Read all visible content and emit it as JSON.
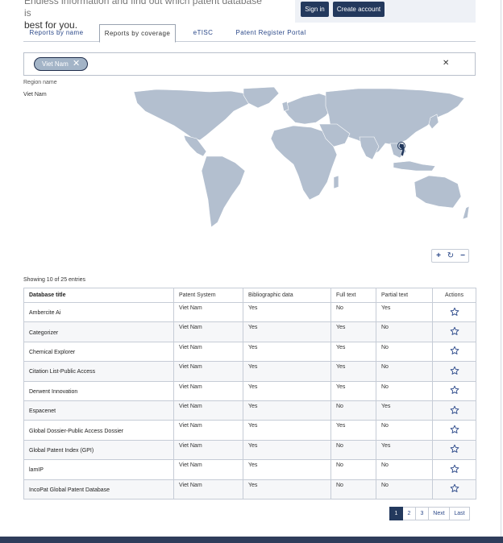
{
  "header": {
    "intro_line1": "Endless information and find out which patent database is",
    "intro_line2": "best for you.",
    "signin_label": "Sign in",
    "create_account_label": "Create account"
  },
  "tabs": [
    {
      "label": "Reports by name",
      "active": false
    },
    {
      "label": "Reports by coverage",
      "active": true
    },
    {
      "label": "eTISC",
      "active": false
    },
    {
      "label": "Patent Register Portal",
      "active": false
    }
  ],
  "filter": {
    "chip_label": "Viet Nam",
    "chip_remove_icon": "close-icon",
    "clear_icon": "close-icon"
  },
  "region": {
    "label": "Region name",
    "value": "Viet Nam"
  },
  "map": {
    "land_color": "#b3bfcf",
    "highlight_color": "#23395d",
    "zoom_in_icon": "+",
    "reset_icon": "↻",
    "zoom_out_icon": "−"
  },
  "table": {
    "showing_text": "Showing 10 of 25 entries",
    "headers": [
      "Database title",
      "Patent System",
      "Bibliographic data",
      "Full text",
      "Partial text",
      "Actions"
    ],
    "rows": [
      {
        "title": "Ambercite Ai",
        "system": "Viet Nam",
        "biblio": "Yes",
        "full": "No",
        "partial": "Yes"
      },
      {
        "title": "Categorizer",
        "system": "Viet Nam",
        "biblio": "Yes",
        "full": "Yes",
        "partial": "No"
      },
      {
        "title": "Chemical Explorer",
        "system": "Viet Nam",
        "biblio": "Yes",
        "full": "Yes",
        "partial": "No"
      },
      {
        "title": "Citation List-Public Access",
        "system": "Viet Nam",
        "biblio": "Yes",
        "full": "Yes",
        "partial": "No"
      },
      {
        "title": "Derwent Innovation",
        "system": "Viet Nam",
        "biblio": "Yes",
        "full": "Yes",
        "partial": "No"
      },
      {
        "title": "Espacenet",
        "system": "Viet Nam",
        "biblio": "Yes",
        "full": "No",
        "partial": "Yes"
      },
      {
        "title": "Global Dossier-Public Access Dossier",
        "system": "Viet Nam",
        "biblio": "Yes",
        "full": "Yes",
        "partial": "No"
      },
      {
        "title": "Global Patent Index (GPI)",
        "system": "Viet Nam",
        "biblio": "Yes",
        "full": "No",
        "partial": "Yes"
      },
      {
        "title": "lamIP",
        "system": "Viet Nam",
        "biblio": "Yes",
        "full": "No",
        "partial": "No"
      },
      {
        "title": "IncoPat Global Patent Database",
        "system": "Viet Nam",
        "biblio": "Yes",
        "full": "No",
        "partial": "No"
      }
    ]
  },
  "pagination": {
    "pages": [
      "1",
      "2",
      "3"
    ],
    "current": "1",
    "next_label": "Next",
    "last_label": "Last"
  },
  "colors": {
    "primary": "#23395d",
    "link": "#2d4a8a",
    "border": "#c6ccd6"
  }
}
